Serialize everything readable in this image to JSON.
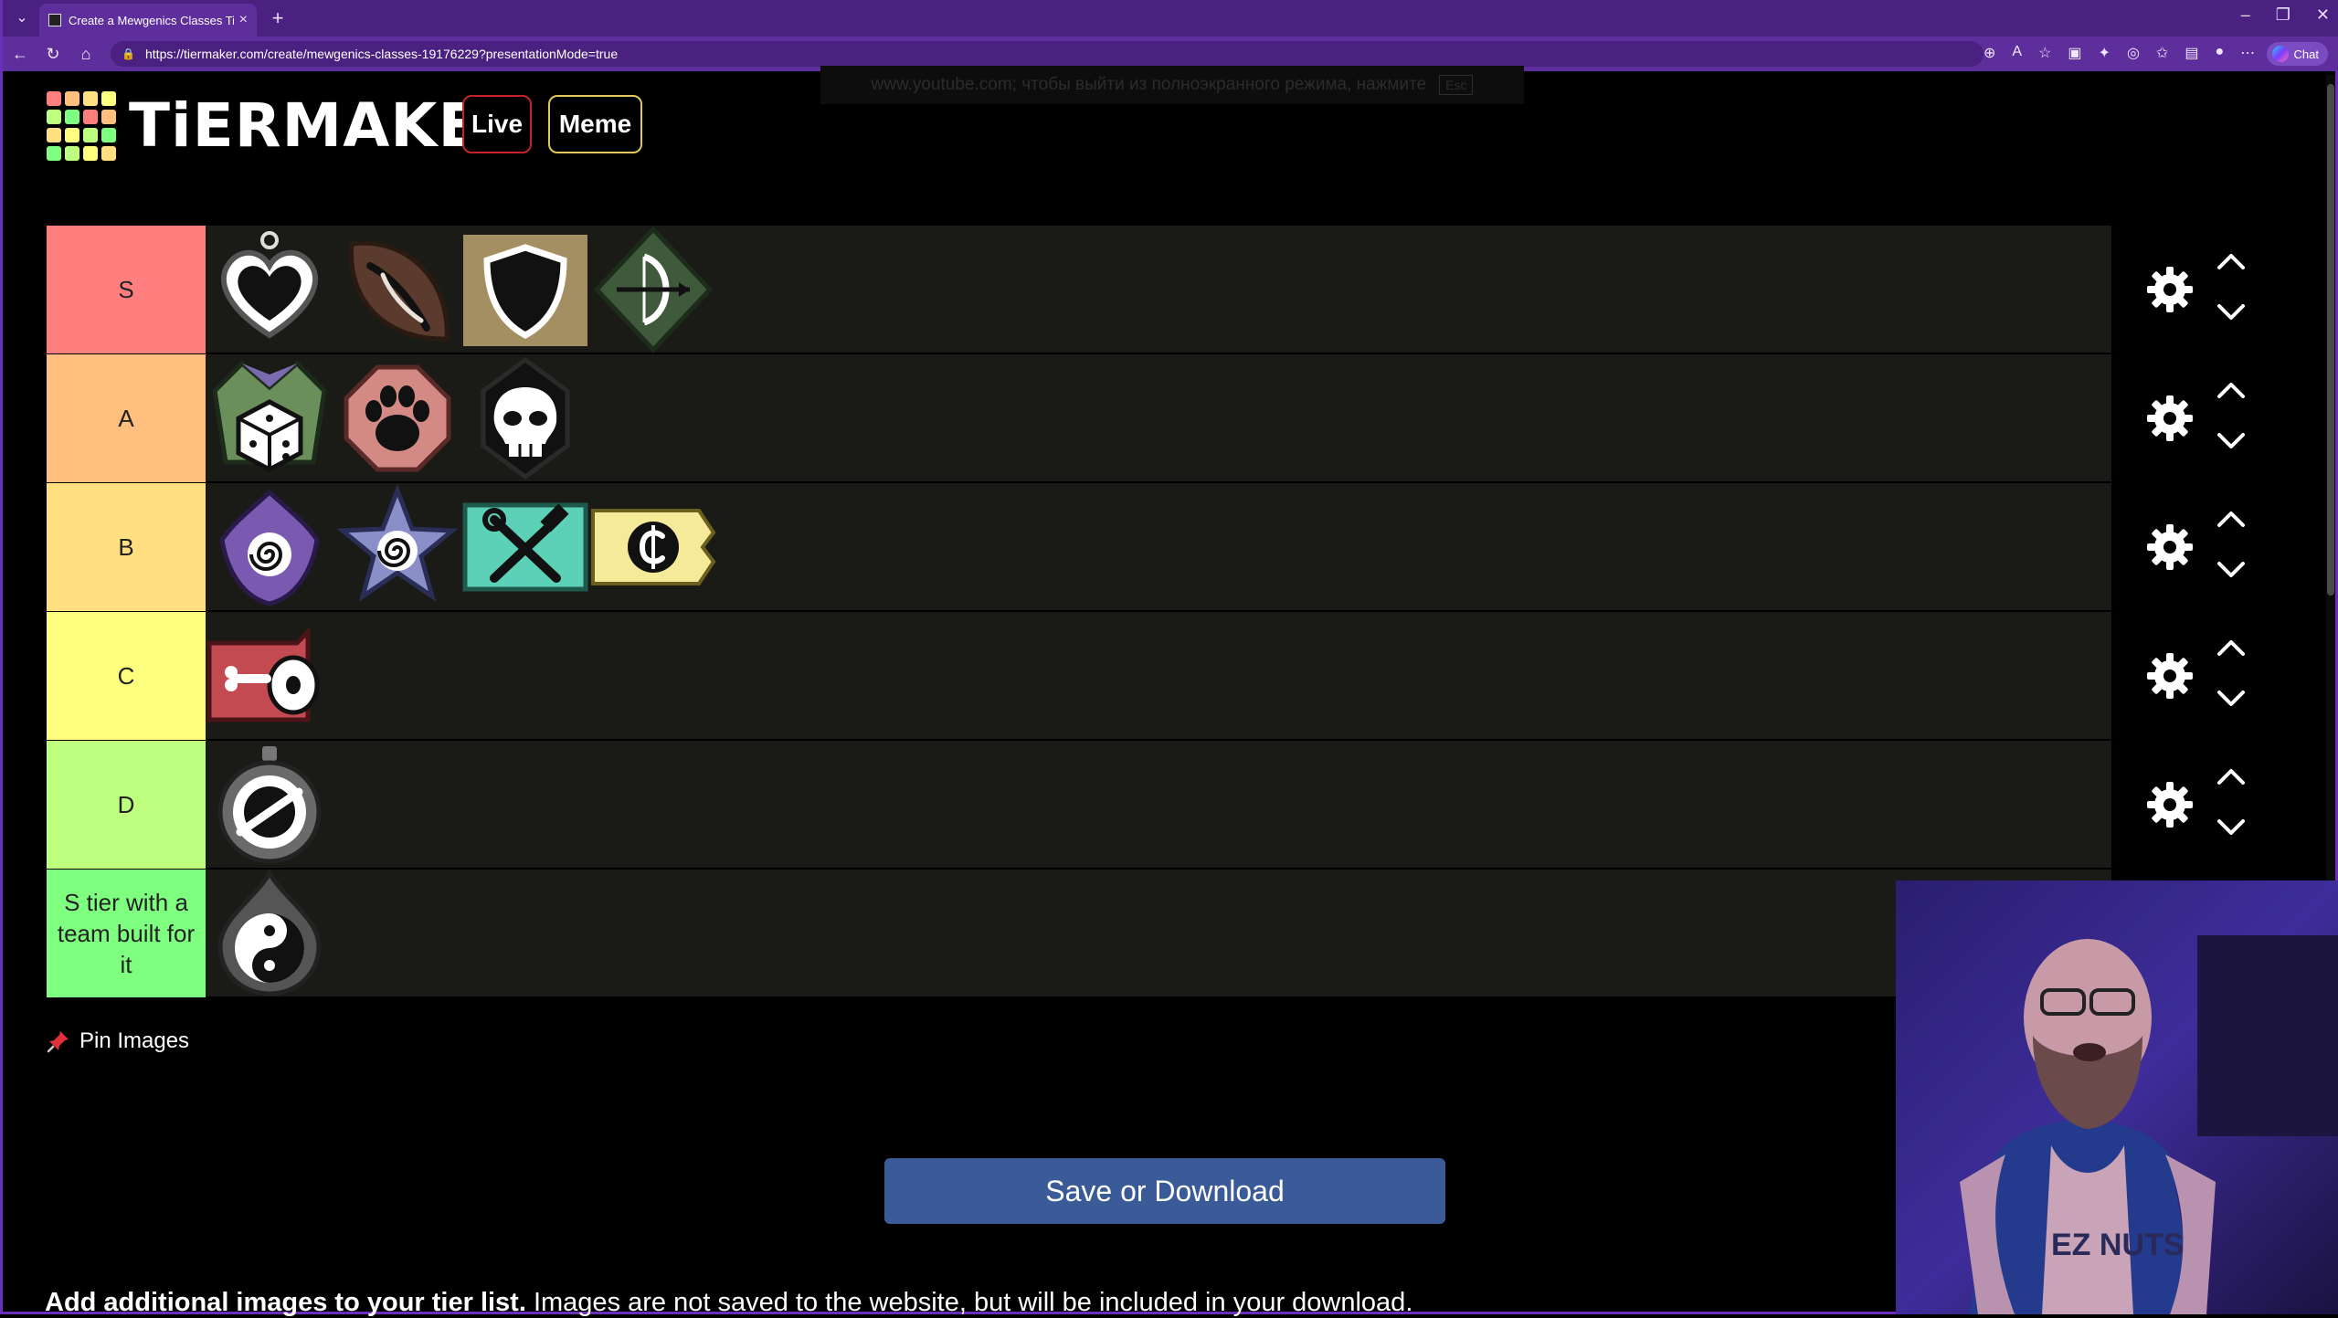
{
  "browser": {
    "tab_title": "Create a Mewgenics Classes Tier L",
    "url": "https://tiermaker.com/create/mewgenics-classes-19176229?presentationMode=true",
    "chat_label": "Chat"
  },
  "fullscreen_notice": {
    "text": "www.youtube.com; чтобы выйти из полноэкранного режима, нажмите",
    "key": "Esc"
  },
  "header": {
    "logo_text": "TiERMAKER",
    "live_label": "Live",
    "meme_label": "Meme",
    "logo_colors": [
      "#ff7f7f",
      "#ffbf7f",
      "#ffdf7f",
      "#ffff7f",
      "#bfff7f",
      "#7fff7f",
      "#ff7f7f",
      "#ffbf7f",
      "#ffdf7f",
      "#ffff7f",
      "#bfff7f",
      "#7fff7f",
      "#7fff7f",
      "#bfff7f",
      "#ffff7f",
      "#ffdf7f"
    ]
  },
  "tiers": [
    {
      "label": "S",
      "color": "#ff7f7f",
      "items": [
        "heart-class-icon",
        "leaf-class-icon",
        "shield-class-icon",
        "archer-class-icon"
      ]
    },
    {
      "label": "A",
      "color": "#ffbf7f",
      "items": [
        "jester-dice-class-icon",
        "paw-class-icon",
        "skull-class-icon"
      ]
    },
    {
      "label": "B",
      "color": "#ffdf7f",
      "items": [
        "spiral-hand-class-icon",
        "spiral-star-class-icon",
        "tools-class-icon",
        "coin-class-icon"
      ]
    },
    {
      "label": "C",
      "color": "#ffff7f",
      "items": [
        "meat-class-icon"
      ]
    },
    {
      "label": "D",
      "color": "#bfff7f",
      "items": [
        "forbidden-class-icon"
      ]
    },
    {
      "label": "S tier with a team built for it",
      "color": "#7fff7f",
      "items": [
        "yin-yang-class-icon"
      ]
    }
  ],
  "pin_label": "Pin Images",
  "save_label": "Save or Download",
  "add_images": {
    "bold": "Add additional images to your tier list.",
    "rest": " Images are not saved to the website, but will be included in your download."
  }
}
